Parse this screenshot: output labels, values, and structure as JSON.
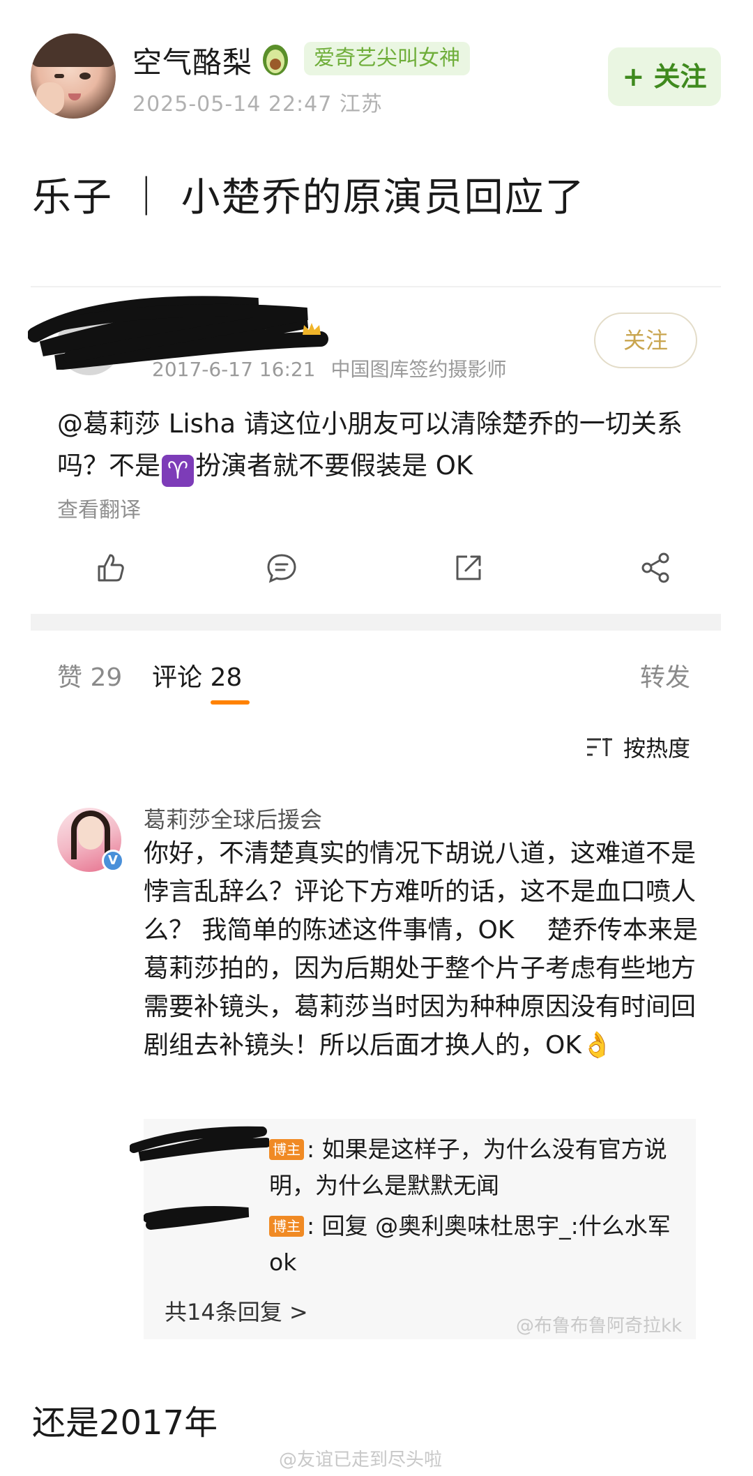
{
  "post": {
    "username": "空气酪梨",
    "badge": "爱奇艺尖叫女神",
    "meta": "2025-05-14 22:47  江苏",
    "follow_label": "+ 关注",
    "title": "乐子 ｜ 小楚乔的原演员回应了",
    "footer_text": "还是2017年",
    "footer_watermark": "@友谊已走到尽头啦"
  },
  "weibo": {
    "meta_time": "2017-6-17 16:21",
    "meta_role": "中国图库签约摄影师",
    "follow_label": "关注",
    "body_part1": "@葛莉莎 Lisha 请这位小朋友可以清除楚乔的一切关系吗？不是",
    "aries_glyph": "♈",
    "body_part2": "扮演者就不要假装是 OK",
    "translate_label": "查看翻译",
    "tabs": {
      "likes": "赞 29",
      "comments": "评论 28",
      "repost": "转发"
    },
    "sort_label": "按热度"
  },
  "comment": {
    "author": "葛莉莎全球后援会",
    "verified_mark": "V",
    "text": "你好，不清楚真实的情况下胡说八道，这难道不是悖言乱辞么？评论下方难听的话，这不是血口喷人么？ 我简单的陈述这件事情，OK　 楚乔传本来是葛莉莎拍的，因为后期处于整个片子考虑有些地方需要补镜头，葛莉莎当时因为种种原因没有时间回剧组去补镜头！所以后面才换人的，OK",
    "ok_emoji": "👌",
    "replies": [
      {
        "badge": "博主",
        "text": ": 如果是这样子，为什么没有官方说明，为什么是默默无闻"
      },
      {
        "badge": "博主",
        "text": ": 回复 @奥利奥味杜思宇_:什么水军 ok"
      }
    ],
    "reply_count": "共14条回复 >",
    "watermark": "@布鲁布鲁阿奇拉kk"
  }
}
